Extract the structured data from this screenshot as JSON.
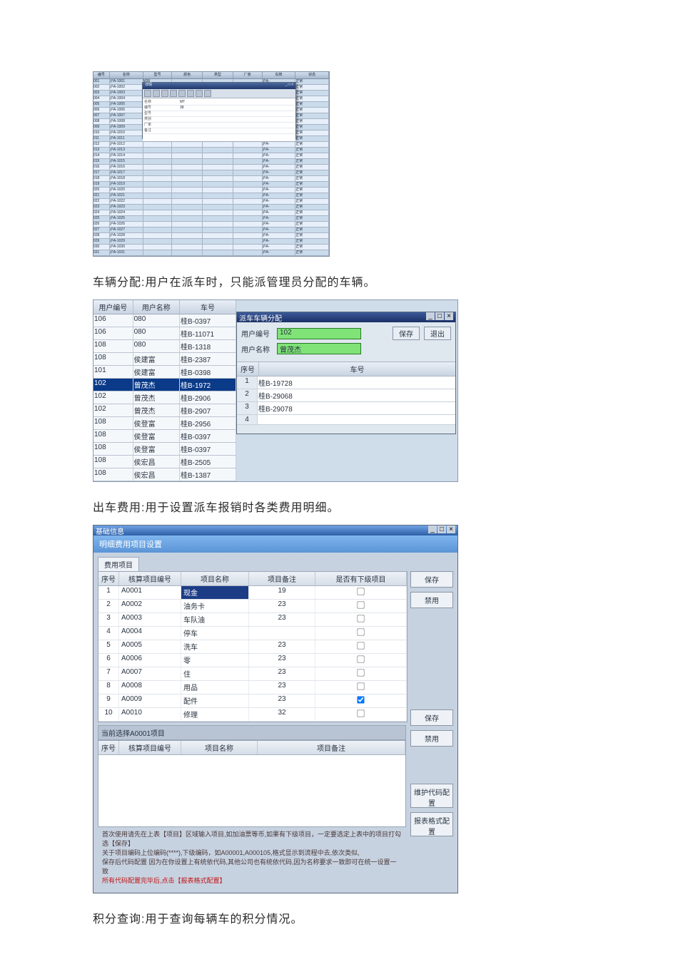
{
  "fig1": {
    "headers": [
      "编号",
      "名称",
      "型号",
      "颜色",
      "类型",
      "厂家",
      "车牌",
      "状态"
    ],
    "rows": [
      [
        "001",
        "沪A-1001",
        "M36",
        "",
        "",
        "",
        "沪A-",
        "正常"
      ],
      [
        "002",
        "沪A-1002",
        "M36",
        "",
        "",
        "",
        "沪A-",
        "正常"
      ],
      [
        "003",
        "沪A-1003",
        "",
        "",
        "",
        "",
        "沪A-",
        "正常"
      ],
      [
        "004",
        "沪A-1004",
        "",
        "",
        "",
        "",
        "沪A-",
        "正常"
      ],
      [
        "005",
        "沪A-1005",
        "",
        "",
        "",
        "",
        "沪A-",
        "正常"
      ],
      [
        "006",
        "沪A-1006",
        "",
        "",
        "",
        "",
        "沪A-",
        "正常"
      ],
      [
        "007",
        "沪A-1007",
        "",
        "",
        "",
        "",
        "沪A-",
        "正常"
      ],
      [
        "008",
        "沪A-1008",
        "",
        "",
        "",
        "",
        "沪A-",
        "正常"
      ],
      [
        "009",
        "沪A-1009",
        "",
        "",
        "",
        "",
        "沪A-",
        "正常"
      ],
      [
        "010",
        "沪A-1010",
        "",
        "",
        "",
        "",
        "沪A-",
        "正常"
      ],
      [
        "011",
        "沪A-1011",
        "",
        "",
        "",
        "",
        "沪A-",
        "正常"
      ],
      [
        "012",
        "沪A-1012",
        "",
        "",
        "",
        "",
        "沪A-",
        "正常"
      ],
      [
        "013",
        "沪A-1013",
        "",
        "",
        "",
        "",
        "沪A-",
        "正常"
      ],
      [
        "014",
        "沪A-1014",
        "",
        "",
        "",
        "",
        "沪A-",
        "正常"
      ],
      [
        "015",
        "沪A-1015",
        "",
        "",
        "",
        "",
        "沪A-",
        "正常"
      ],
      [
        "016",
        "沪A-1016",
        "",
        "",
        "",
        "",
        "沪A-",
        "正常"
      ],
      [
        "017",
        "沪A-1017",
        "",
        "",
        "",
        "",
        "沪A-",
        "正常"
      ],
      [
        "018",
        "沪A-1018",
        "",
        "",
        "",
        "",
        "沪A-",
        "正常"
      ],
      [
        "019",
        "沪A-1019",
        "",
        "",
        "",
        "",
        "沪A-",
        "正常"
      ],
      [
        "020",
        "沪A-1020",
        "",
        "",
        "",
        "",
        "沪A-",
        "正常"
      ],
      [
        "021",
        "沪A-1021",
        "",
        "",
        "",
        "",
        "沪A-",
        "正常"
      ],
      [
        "022",
        "沪A-1022",
        "",
        "",
        "",
        "",
        "沪A-",
        "正常"
      ],
      [
        "023",
        "沪A-1023",
        "",
        "",
        "",
        "",
        "沪A-",
        "正常"
      ],
      [
        "024",
        "沪A-1024",
        "",
        "",
        "",
        "",
        "沪A-",
        "正常"
      ],
      [
        "025",
        "沪A-1025",
        "",
        "",
        "",
        "",
        "沪A-",
        "正常"
      ],
      [
        "026",
        "沪A-1026",
        "",
        "",
        "",
        "",
        "沪A-",
        "正常"
      ],
      [
        "027",
        "沪A-1027",
        "",
        "",
        "",
        "",
        "沪A-",
        "正常"
      ],
      [
        "028",
        "沪A-1028",
        "",
        "",
        "",
        "",
        "沪A-",
        "正常"
      ],
      [
        "029",
        "沪A-1029",
        "",
        "",
        "",
        "",
        "沪A-",
        "正常"
      ],
      [
        "030",
        "沪A-1030",
        "",
        "",
        "",
        "",
        "沪A-",
        "正常"
      ],
      [
        "031",
        "沪A-1031",
        "",
        "",
        "",
        "",
        "沪A-",
        "正常"
      ]
    ],
    "modal": {
      "title": "详情",
      "rows": [
        [
          "名称",
          "MT"
        ],
        [
          "编号",
          "38"
        ],
        [
          "型号",
          ""
        ],
        [
          "类别",
          ""
        ],
        [
          "厂家",
          ""
        ],
        [
          "备注",
          ""
        ]
      ]
    }
  },
  "para1": "车辆分配:用户在派车时，只能派管理员分配的车辆。",
  "fig2": {
    "left_headers": [
      "用户编号",
      "用户名称",
      "车号"
    ],
    "left_rows": [
      [
        "106",
        "080",
        "桂B-0397"
      ],
      [
        "106",
        "080",
        "桂B-11071"
      ],
      [
        "108",
        "080",
        "桂B-1318"
      ],
      [
        "108",
        "侯建富",
        "桂B-2387"
      ],
      [
        "101",
        "侯建富",
        "桂B-0398"
      ],
      [
        "102",
        "曾茂杰",
        "桂B-1972"
      ],
      [
        "102",
        "曾茂杰",
        "桂B-2906"
      ],
      [
        "102",
        "曾茂杰",
        "桂B-2907"
      ],
      [
        "108",
        "侯登富",
        "桂B-2956"
      ],
      [
        "108",
        "侯登富",
        "桂B-0397"
      ],
      [
        "108",
        "侯登富",
        "桂B-0397"
      ],
      [
        "108",
        "侯宏昌",
        "桂B-2505"
      ],
      [
        "108",
        "侯宏昌",
        "桂B-1387"
      ]
    ],
    "left_selected_index": 5,
    "dlg": {
      "title": "派车车辆分配",
      "user_id_label": "用户编号",
      "user_name_label": "用户名称",
      "user_id": "102",
      "user_name": "曾茂杰",
      "save": "保存",
      "run": "退出",
      "sub_headers": [
        "序号",
        "车号"
      ],
      "sub_rows": [
        [
          "1",
          "桂B-19728"
        ],
        [
          "2",
          "桂B-29068"
        ],
        [
          "3",
          "桂B-29078"
        ],
        [
          "4",
          ""
        ]
      ]
    }
  },
  "para2": "出车费用:用于设置派车报销时各类费用明细。",
  "fig3": {
    "win_title": "基础信息",
    "subtitle": "明细费用项目设置",
    "tab": "费用项目",
    "headers": [
      "序号",
      "核算项目编号",
      "项目名称",
      "项目备注",
      "是否有下级项目"
    ],
    "rows": [
      {
        "n": "1",
        "code": "A0001",
        "name": "现金",
        "note": "19",
        "chk": false,
        "sel": true
      },
      {
        "n": "2",
        "code": "A0002",
        "name": "油务卡",
        "note": "23",
        "chk": false
      },
      {
        "n": "3",
        "code": "A0003",
        "name": "车队油",
        "note": "23",
        "chk": false
      },
      {
        "n": "4",
        "code": "A0004",
        "name": "停车",
        "note": "",
        "chk": false
      },
      {
        "n": "5",
        "code": "A0005",
        "name": "洗车",
        "note": "23",
        "chk": false
      },
      {
        "n": "6",
        "code": "A0006",
        "name": "零",
        "note": "23",
        "chk": false
      },
      {
        "n": "7",
        "code": "A0007",
        "name": "住",
        "note": "23",
        "chk": false
      },
      {
        "n": "8",
        "code": "A0008",
        "name": "用品",
        "note": "23",
        "chk": false
      },
      {
        "n": "9",
        "code": "A0009",
        "name": "配件",
        "note": "23",
        "chk": true
      },
      {
        "n": "10",
        "code": "A0010",
        "name": "修理",
        "note": "32",
        "chk": false
      }
    ],
    "section2_title": "当前选择A0001项目",
    "headers2": [
      "序号",
      "核算项目编号",
      "项目名称",
      "项目备注"
    ],
    "side": {
      "save": "保存",
      "disable": "禁用",
      "save2": "保存",
      "disable2": "禁用",
      "code_cfg": "维护代码配置",
      "report_cfg": "报表格式配置"
    },
    "notes_l1": "首次使用请先在上表【项目】区域输入项目,如加油票等币,如果有下级项目，一定要选定上表中的项目打勾选【保存】",
    "notes_l2": "关于项目编码上位编码(****),下级编码，如A00001,A000105,格式显示到流程中去,依次类似,",
    "notes_l3": "保存后代码配置 因为在你设置上有统依代码,其他公司也有统依代码,因为名称要求一致即可在统一设置一致",
    "notes_red": "所有代码配置完毕后,点击【报表格式配置】"
  },
  "para3": "积分查询:用于查询每辆车的积分情况。"
}
